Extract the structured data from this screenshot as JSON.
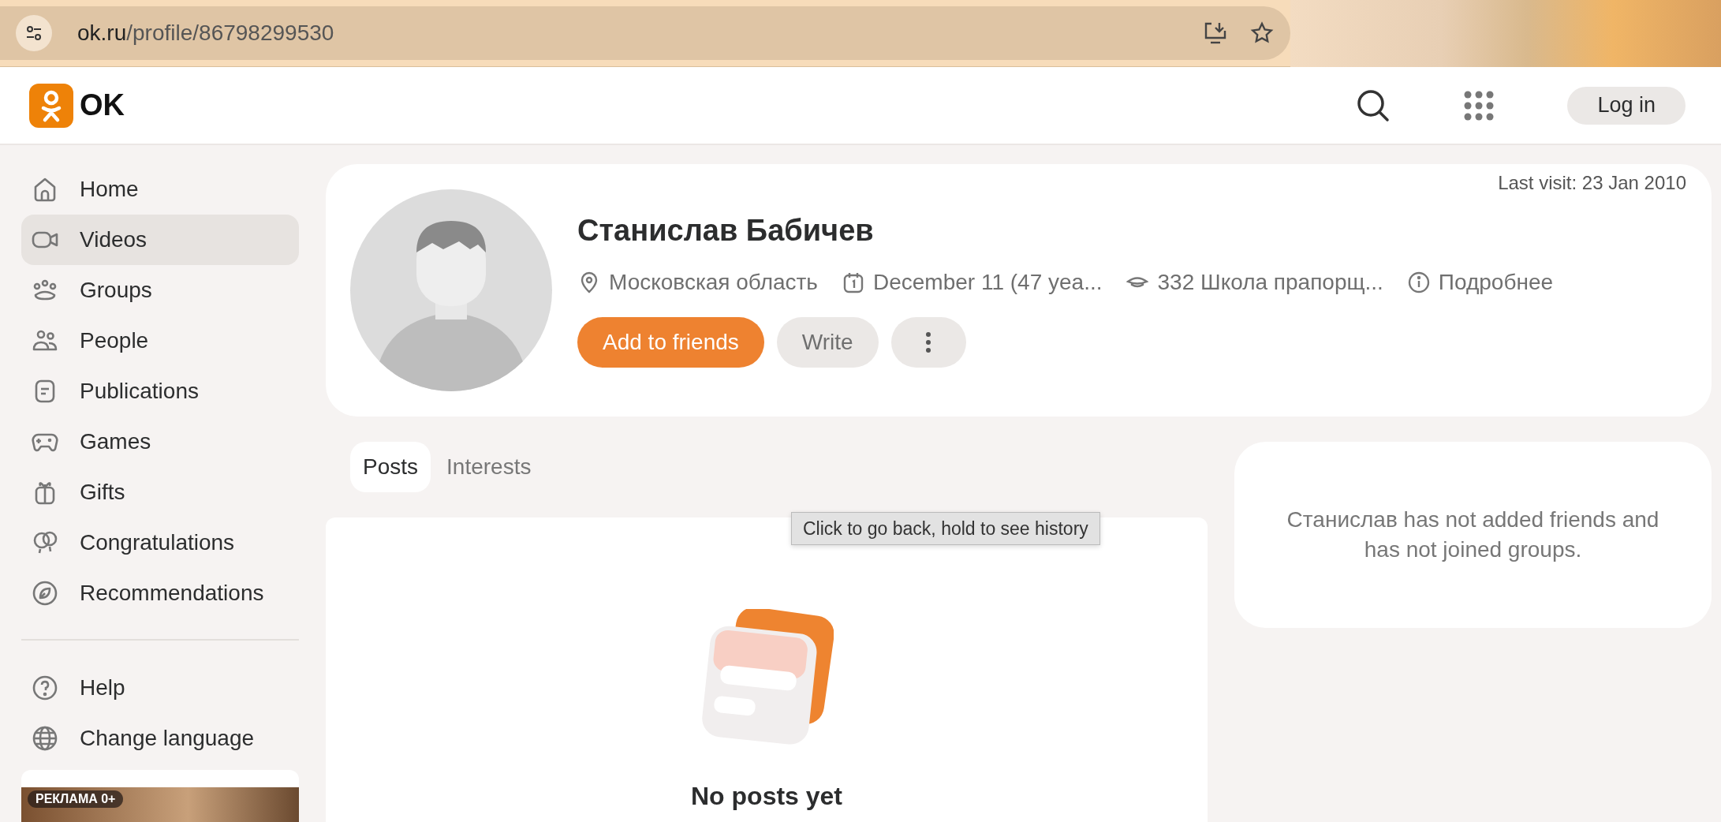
{
  "browser": {
    "url_host": "ok.ru",
    "url_path": "/profile/86798299530"
  },
  "header": {
    "logo_text": "OK",
    "login": "Log in"
  },
  "sidebar": {
    "items": [
      {
        "label": "Home",
        "selected": false
      },
      {
        "label": "Videos",
        "selected": true
      },
      {
        "label": "Groups",
        "selected": false
      },
      {
        "label": "People",
        "selected": false
      },
      {
        "label": "Publications",
        "selected": false
      },
      {
        "label": "Games",
        "selected": false
      },
      {
        "label": "Gifts",
        "selected": false
      },
      {
        "label": "Congratulations",
        "selected": false
      },
      {
        "label": "Recommendations",
        "selected": false
      }
    ],
    "footer_items": [
      {
        "label": "Help"
      },
      {
        "label": "Change language"
      }
    ],
    "ad_badge": "РЕКЛАМА 0+"
  },
  "profile": {
    "last_visit": "Last visit: 23 Jan 2010",
    "name": "Станислав Бабичев",
    "info": [
      {
        "text": "Московская область"
      },
      {
        "text": "December 11 (47 yea..."
      },
      {
        "text": "332 Школа прапорщ..."
      },
      {
        "text": "Подробнее"
      }
    ],
    "add_friend": "Add to friends",
    "write": "Write"
  },
  "tabs": [
    {
      "label": "Posts",
      "selected": true
    },
    {
      "label": "Interests",
      "selected": false
    }
  ],
  "posts": {
    "empty_title": "No posts yet"
  },
  "friends_card": {
    "text": "Станислав has not added friends and has not joined groups."
  },
  "tooltip": {
    "text": "Click to go back, hold to see history"
  }
}
